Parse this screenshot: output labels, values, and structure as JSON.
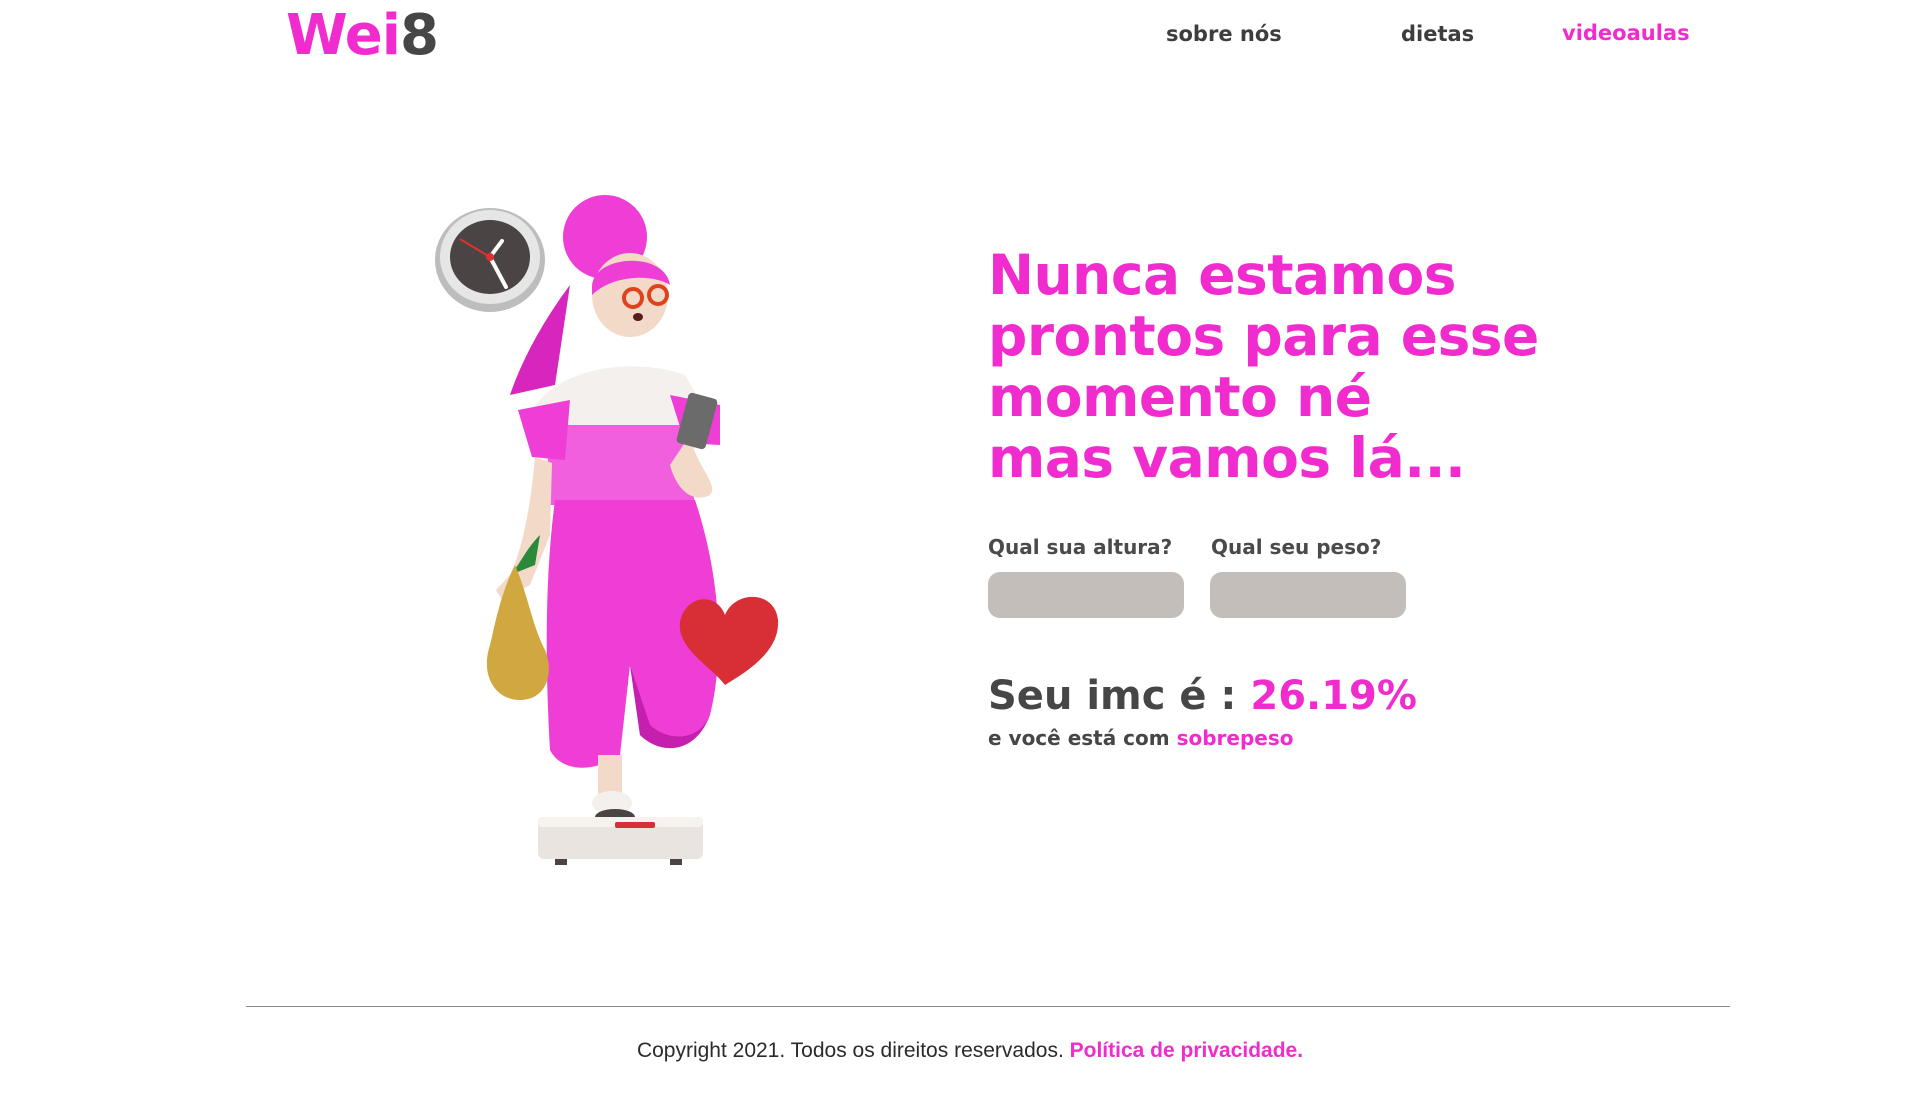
{
  "header": {
    "logo_text": "Wei",
    "logo_digit": "8",
    "nav": [
      {
        "label": "sobre nós"
      },
      {
        "label": "dietas"
      },
      {
        "label": "videoaulas"
      }
    ]
  },
  "hero": {
    "headline_lines": [
      "Nunca estamos",
      "prontos para esse",
      "momento né",
      "mas vamos lá..."
    ],
    "height_label": "Qual sua altura?",
    "height_value": "",
    "weight_label": "Qual seu peso?",
    "weight_value": "",
    "imc_prefix": "Seu imc é :",
    "imc_value": "26.19%",
    "status_prefix": "e você está com",
    "status_value": "sobrepeso"
  },
  "footer": {
    "copyright": "Copyright 2021. Todos os direitos reservados.",
    "privacy_link": "Política de privacidade."
  },
  "colors": {
    "brand_pink": "#f02ccf",
    "text_dark": "#464646",
    "input_bg": "#c4bebb",
    "divider": "#8a8a8a"
  },
  "illustration": {
    "icons": [
      "clock-icon",
      "pear-icon",
      "heart-icon",
      "scale-icon",
      "phone-icon"
    ]
  }
}
